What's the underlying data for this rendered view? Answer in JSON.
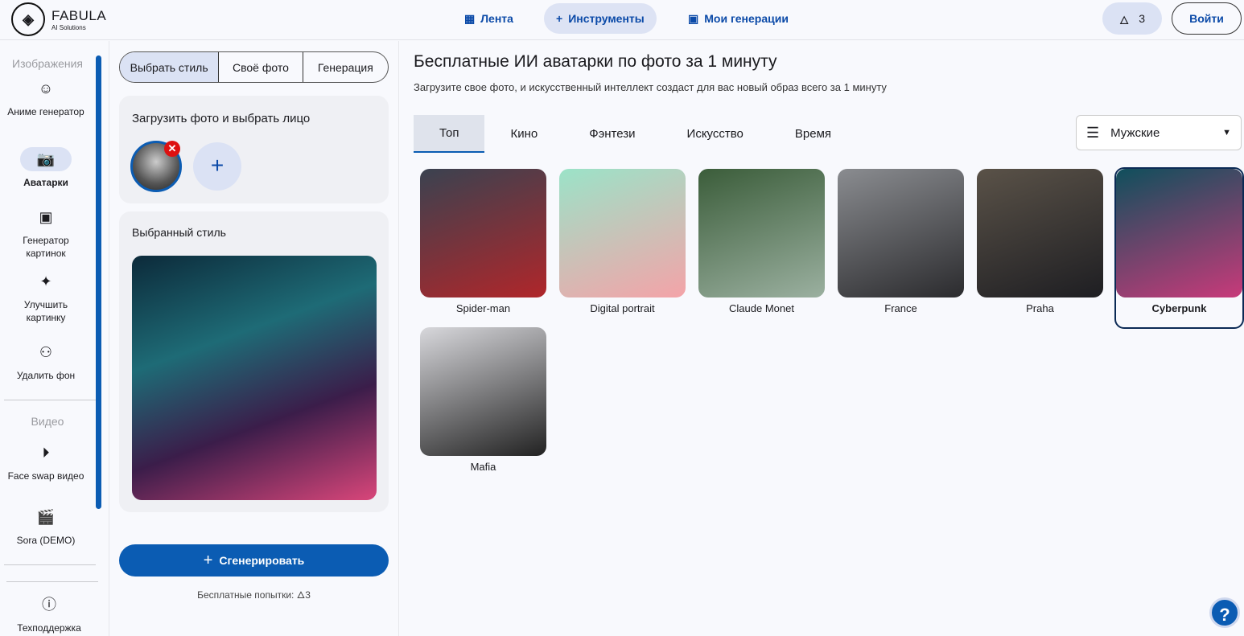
{
  "header": {
    "brand": "FABULA",
    "brand_sub": "AI Solutions",
    "nav": [
      {
        "label": "Лента",
        "icon": "grid-icon"
      },
      {
        "label": "Инструменты",
        "icon": "plus-icon",
        "active": true
      },
      {
        "label": "Мои генерации",
        "icon": "image-icon"
      }
    ],
    "credits": "3",
    "login": "Войти"
  },
  "sidebar": {
    "section_images": "Изображения",
    "section_video": "Видео",
    "items": [
      {
        "label": "Аниме генератор",
        "icon": "anime-icon"
      },
      {
        "label": "Аватарки",
        "icon": "camera-plus-icon",
        "active": true
      },
      {
        "label": "Генератор картинок",
        "icon": "image-plus-icon"
      },
      {
        "label": "Улучшить картинку",
        "icon": "sparkles-icon"
      },
      {
        "label": "Удалить фон",
        "icon": "remove-bg-icon"
      },
      {
        "label": "Face swap видео",
        "icon": "play-circle-icon"
      },
      {
        "label": "Sora (DEMO)",
        "icon": "clapperboard-icon"
      },
      {
        "label": "Техподдержка",
        "icon": "alert-circle-icon"
      }
    ]
  },
  "panel": {
    "steps": [
      "Выбрать стиль",
      "Своё фото",
      "Генерация"
    ],
    "upload_title": "Загрузить фото и выбрать лицо",
    "selected_title": "Выбранный стиль",
    "generate": "Сгенерировать",
    "free_attempts": "Бесплатные попытки: ",
    "free_count": "3"
  },
  "main": {
    "title": "Бесплатные ИИ аватарки по фото за 1 минуту",
    "subtitle": "Загрузите свое фото, и искусственный интеллект создаст для вас новый образ всего за 1 минуту",
    "tabs": [
      "Топ",
      "Кино",
      "Фэнтези",
      "Искусство",
      "Время"
    ],
    "active_tab": "Топ",
    "filter": "Мужские",
    "styles": [
      {
        "name": "Spider-man",
        "colors": [
          "#3a4250",
          "#b0262a"
        ]
      },
      {
        "name": "Digital portrait",
        "colors": [
          "#9be3c8",
          "#f4a3a8"
        ]
      },
      {
        "name": "Claude Monet",
        "colors": [
          "#3b5d3a",
          "#9bb0a0"
        ]
      },
      {
        "name": "France",
        "colors": [
          "#8a8c90",
          "#2b2b2e"
        ]
      },
      {
        "name": "Praha",
        "colors": [
          "#5a5248",
          "#1e1e22"
        ]
      },
      {
        "name": "Cyberpunk",
        "colors": [
          "#0f4f5c",
          "#c83a7a"
        ],
        "selected": true
      },
      {
        "name": "Mafia",
        "colors": [
          "#d8d8dc",
          "#222"
        ]
      }
    ]
  }
}
